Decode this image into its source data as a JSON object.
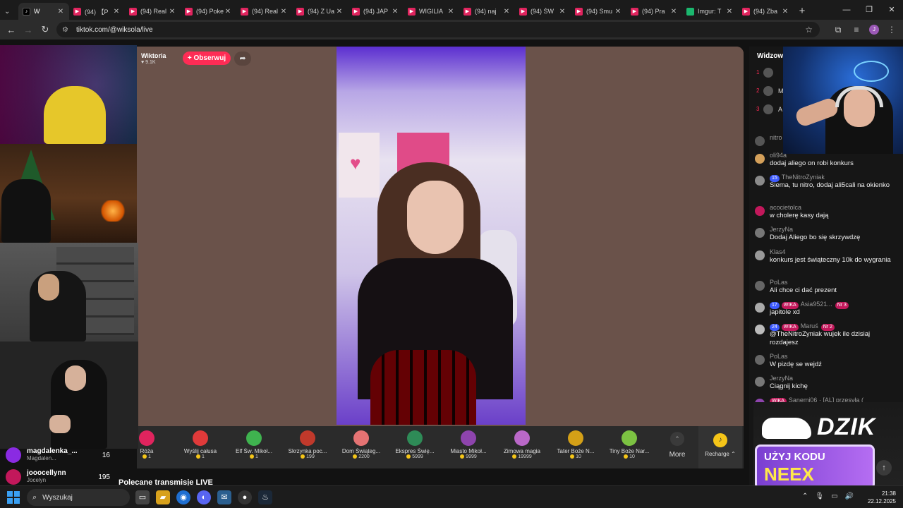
{
  "browser": {
    "tabs": [
      {
        "label": "W",
        "favicon": "tiktok",
        "active": true
      },
      {
        "label": "(94) 【P",
        "favicon": "youtube"
      },
      {
        "label": "(94) Real",
        "favicon": "youtube"
      },
      {
        "label": "(94) Poke",
        "favicon": "youtube"
      },
      {
        "label": "(94) Real",
        "favicon": "youtube"
      },
      {
        "label": "(94) Z Ua",
        "favicon": "youtube"
      },
      {
        "label": "(94) JAP",
        "favicon": "youtube"
      },
      {
        "label": "WIGILIA",
        "favicon": "youtube"
      },
      {
        "label": "(94) naj",
        "favicon": "youtube"
      },
      {
        "label": "(94) ŚW",
        "favicon": "youtube"
      },
      {
        "label": "(94) Smu",
        "favicon": "youtube"
      },
      {
        "label": "(94) Pra",
        "favicon": "youtube"
      },
      {
        "label": "Imgur: T",
        "favicon": "imgur"
      },
      {
        "label": "(94) Zba",
        "favicon": "youtube"
      }
    ],
    "new_tab_icon": "plus-icon",
    "url": "tiktok.com/@wiksola/live"
  },
  "leaderboard": [
    {
      "name": "magdalenka_...",
      "sub": "Magdalen...",
      "score": "16"
    },
    {
      "name": "jooocellynn",
      "sub": "Jocelyn",
      "score": "195"
    }
  ],
  "live": {
    "host_name": "Wiktoria",
    "host_likes": "9.1K",
    "follow_label": "+ Obserwuj",
    "gifts": [
      {
        "name": "Róża",
        "price": "1",
        "color": "#e0245e"
      },
      {
        "name": "Wyślij całusa",
        "price": "1",
        "color": "#e03a3a"
      },
      {
        "name": "Elf Św. Mikoł...",
        "price": "1",
        "color": "#3fb34f"
      },
      {
        "name": "Skrzynka poc...",
        "price": "199",
        "color": "#c0392b"
      },
      {
        "name": "Dom Świąteg...",
        "price": "2200",
        "color": "#e57373"
      },
      {
        "name": "Ekspres Świę...",
        "price": "5999",
        "color": "#2e8b57"
      },
      {
        "name": "Miasto Mikoł...",
        "price": "9999",
        "color": "#8e44ad"
      },
      {
        "name": "Zimowa magia",
        "price": "19999",
        "color": "#ba68c8"
      },
      {
        "name": "Tater Boże N...",
        "price": "10",
        "color": "#d4a017"
      },
      {
        "name": "Tiny Boże Nar...",
        "price": "10",
        "color": "#7cc242"
      }
    ],
    "more_label": "More",
    "recharge_label": "Recharge",
    "recommended_title": "Polecane transmisje LIVE"
  },
  "right_panel": {
    "viewers_heading": "Widzow",
    "viewers": [
      {
        "rank": "1",
        "name": ""
      },
      {
        "rank": "2",
        "name": "M"
      },
      {
        "rank": "3",
        "name": "A"
      }
    ],
    "chat": [
      {
        "user": "nitro",
        "text": "",
        "lvl": "",
        "fan": ""
      },
      {
        "user": "oli94a",
        "text": "dodaj aliego on robi konkurs",
        "lvl": "",
        "fan": ""
      },
      {
        "user": "TheNitroZyniak",
        "text": "Siema, tu nitro, dodaj ali5cali na okienko",
        "lvl": "15",
        "fan": ""
      },
      {
        "user": "acocietolca",
        "text": "w cholerę kasy dają",
        "lvl": "",
        "fan": ""
      },
      {
        "user": "JerzyNa",
        "text": "Dodaj Aliego bo się skrzywdzę",
        "lvl": "",
        "fan": ""
      },
      {
        "user": "Klas4",
        "text": "konkurs jest świąteczny 10k do wygrania",
        "lvl": "",
        "fan": ""
      },
      {
        "user": "PoLas",
        "text": "Ali chce ci dać prezent",
        "lvl": "",
        "fan": ""
      },
      {
        "user": "Asia9521...",
        "text": "japitole xd",
        "lvl": "17",
        "fan": "WIKA",
        "extra": "Nr 3"
      },
      {
        "user": "Maruś",
        "text": "@TheNitroZyniak wujek ile dzisiaj rozdajesz",
        "lvl": "24",
        "fan": "WIKA",
        "extra": "Nr 2"
      },
      {
        "user": "PoLas",
        "text": "W pizdę se wejdź",
        "lvl": "",
        "fan": ""
      },
      {
        "user": "JerzyNa",
        "text": "Ciągnij kichę",
        "lvl": "",
        "fan": ""
      },
      {
        "user": "Sanemi06 · [AL] przesyła (",
        "text": "",
        "lvl": "",
        "fan": "WIKA"
      }
    ]
  },
  "ad": {
    "brand": "DZIK",
    "line1": "UŻYJ KODU",
    "line2": "NEEX"
  },
  "taskbar": {
    "search_placeholder": "Wyszukaj",
    "time": "21:38",
    "date": "22.12.2025"
  }
}
